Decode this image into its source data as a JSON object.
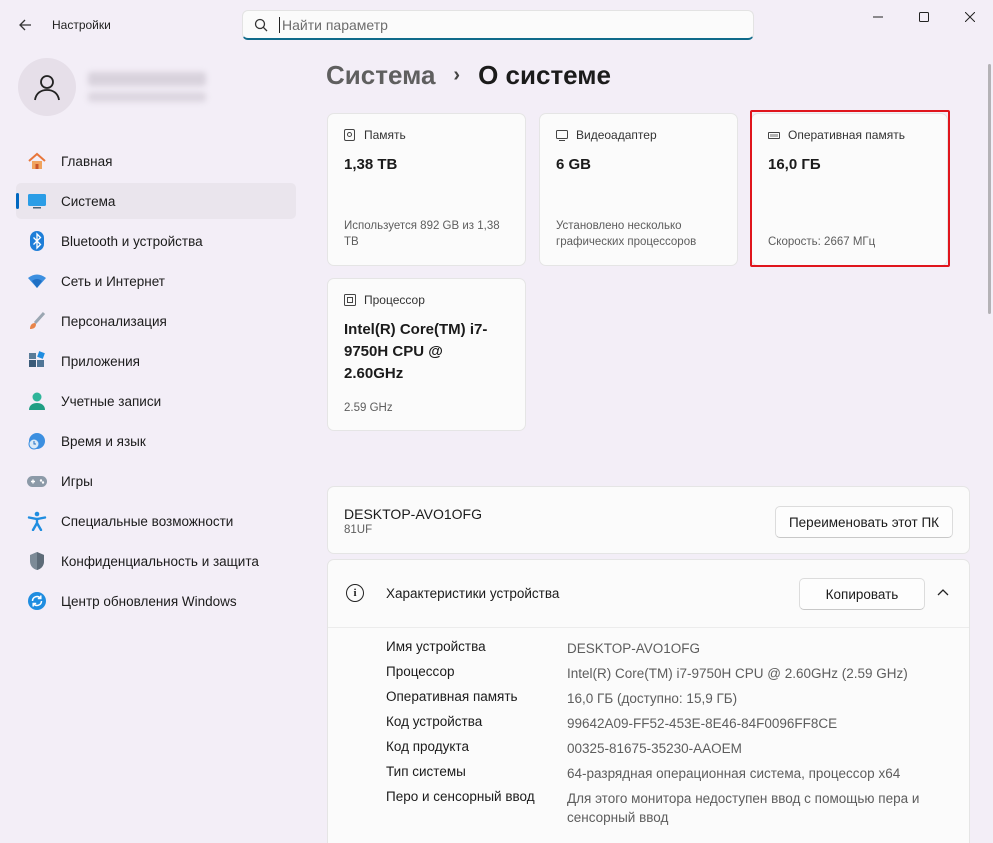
{
  "app": {
    "title": "Настройки"
  },
  "search": {
    "placeholder": "Найти параметр"
  },
  "nav": {
    "items": [
      {
        "label": "Главная",
        "icon": "home-icon"
      },
      {
        "label": "Система",
        "icon": "system-icon",
        "active": true
      },
      {
        "label": "Bluetooth и устройства",
        "icon": "bluetooth-icon"
      },
      {
        "label": "Сеть и Интернет",
        "icon": "wifi-icon"
      },
      {
        "label": "Персонализация",
        "icon": "brush-icon"
      },
      {
        "label": "Приложения",
        "icon": "apps-icon"
      },
      {
        "label": "Учетные записи",
        "icon": "account-icon"
      },
      {
        "label": "Время и язык",
        "icon": "time-language-icon"
      },
      {
        "label": "Игры",
        "icon": "gamepad-icon"
      },
      {
        "label": "Специальные возможности",
        "icon": "accessibility-icon"
      },
      {
        "label": "Конфиденциальность и защита",
        "icon": "shield-icon"
      },
      {
        "label": "Центр обновления Windows",
        "icon": "update-icon"
      }
    ]
  },
  "header": {
    "parent": "Система",
    "separator": "›",
    "current": "О системе"
  },
  "cards": {
    "storage": {
      "label": "Память",
      "value": "1,38 TB",
      "footer": "Используется 892 GB из 1,38 TB"
    },
    "gpu": {
      "label": "Видеоадаптер",
      "value": "6 GB",
      "footer": "Установлено несколько графических процессоров"
    },
    "ram": {
      "label": "Оперативная память",
      "value": "16,0 ГБ",
      "footer": "Скорость: 2667 МГц"
    },
    "cpu": {
      "label": "Процессор",
      "value": "Intel(R) Core(TM) i7-9750H CPU @ 2.60GHz",
      "footer": "2.59 GHz"
    }
  },
  "device": {
    "name": "DESKTOP-AVO1OFG",
    "model": "81UF",
    "rename_label": "Переименовать этот ПК"
  },
  "specs": {
    "title": "Характеристики устройства",
    "copy_label": "Копировать",
    "rows": [
      {
        "key": "Имя устройства",
        "value": "DESKTOP-AVO1OFG"
      },
      {
        "key": "Процессор",
        "value": "Intel(R) Core(TM) i7-9750H CPU @ 2.60GHz (2.59 GHz)"
      },
      {
        "key": "Оперативная память",
        "value": "16,0 ГБ (доступно: 15,9 ГБ)"
      },
      {
        "key": "Код устройства",
        "value": "99642A09-FF52-453E-8E46-84F0096FF8CE"
      },
      {
        "key": "Код продукта",
        "value": "00325-81675-35230-AAOEM"
      },
      {
        "key": "Тип системы",
        "value": "64-разрядная операционная система, процессор x64"
      },
      {
        "key": "Перо и сенсорный ввод",
        "value": "Для этого монитора недоступен ввод с помощью пера и сенсорный ввод"
      }
    ]
  },
  "colors": {
    "accent": "#0067c0",
    "highlight": "#e0151c",
    "background": "#f3eef7"
  }
}
